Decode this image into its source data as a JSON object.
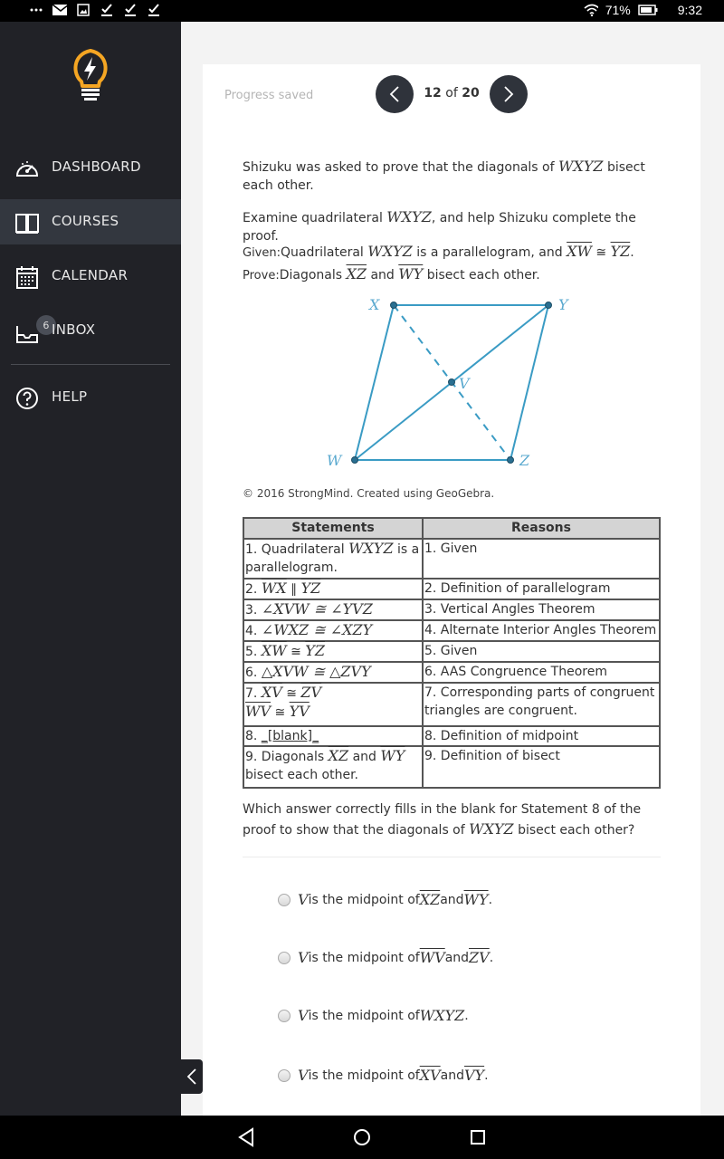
{
  "status_bar": {
    "battery_percent": "71%",
    "time": "9:32",
    "left_icons": [
      "more-icon",
      "mail-icon",
      "image-icon",
      "check-icon",
      "check-icon",
      "check-icon"
    ],
    "right_icons": [
      "wifi-icon",
      "battery-icon"
    ]
  },
  "sidebar": {
    "items": [
      {
        "label": "DASHBOARD",
        "icon": "speedometer-icon",
        "active": false
      },
      {
        "label": "COURSES",
        "icon": "book-icon",
        "active": true
      },
      {
        "label": "CALENDAR",
        "icon": "calendar-icon",
        "active": false
      },
      {
        "label": "INBOX",
        "icon": "inbox-icon",
        "active": false,
        "badge": "6"
      },
      {
        "label": "HELP",
        "icon": "help-icon",
        "active": false
      }
    ],
    "accent_color": "#f5a623"
  },
  "header": {
    "progress_status": "Progress saved",
    "current_page": "12",
    "page_sep": "of",
    "total_pages": "20"
  },
  "question": {
    "intro_a": "Shizuku was asked to prove that the diagonals of ",
    "intro_b": " bisect each other.",
    "quad": "WXYZ",
    "examine_a": "Examine quadrilateral ",
    "examine_b": ", and help Shizuku complete the proof.",
    "given_label": "Given:",
    "given_a": "Quadrilateral ",
    "given_b": " is a parallelogram, and ",
    "given_seg1": "XW",
    "given_seg2": "YZ",
    "prove_label": "Prove:",
    "prove_a": "Diagonals ",
    "prove_seg1": "XZ",
    "prove_and": " and ",
    "prove_seg2": "WY",
    "prove_b": " bisect each other.",
    "copyright": "© 2016 StrongMind. Created using GeoGebra.",
    "prompt_a": "Which answer correctly fills in the blank for Statement 8 of the proof to show that the diagonals of ",
    "prompt_b": " bisect each other?"
  },
  "diagram": {
    "points": {
      "X": "X",
      "Y": "Y",
      "Z": "Z",
      "W": "W",
      "V": "V"
    },
    "color": "#3a9bc4"
  },
  "proof_table": {
    "headers": [
      "Statements",
      "Reasons"
    ],
    "rows": [
      {
        "statement": "1. Quadrilateral WXYZ is a parallelogram.",
        "reason": "1. Given"
      },
      {
        "statement": "2. WX ∥ YZ",
        "reason": "2. Definition of parallelogram"
      },
      {
        "statement": "3. ∠XVW ≅ ∠YVZ",
        "reason": "3. Vertical Angles Theorem"
      },
      {
        "statement": "4. ∠WXZ ≅ ∠XZY",
        "reason": "4. Alternate Interior Angles Theorem"
      },
      {
        "statement": "5. XW ≅ YZ",
        "reason": "5. Given"
      },
      {
        "statement": "6. △XVW ≅ △ZVY",
        "reason": "6. AAS Congruence Theorem"
      },
      {
        "statement": "7. XV ≅ ZV, WV ≅ YV",
        "reason": "7. Corresponding parts of congruent triangles are congruent."
      },
      {
        "statement": "8. _[blank]_",
        "reason": "8. Definition of midpoint"
      },
      {
        "statement": "9. Diagonals XZ and WY bisect each other.",
        "reason": "9. Definition of bisect"
      }
    ]
  },
  "choices": [
    {
      "v": "V",
      "text": " is the midpoint of ",
      "seg1": "XZ",
      "and": " and ",
      "seg2": "WY",
      "end": "."
    },
    {
      "v": "V",
      "text": " is the midpoint of ",
      "seg1": "WV",
      "and": " and ",
      "seg2": "ZV",
      "end": "."
    },
    {
      "v": "V",
      "text": " is the midpoint of ",
      "seg1": "WXYZ",
      "and": "",
      "seg2": "",
      "end": "."
    },
    {
      "v": "V",
      "text": " is the midpoint of ",
      "seg1": "XV",
      "and": " and ",
      "seg2": "VY",
      "end": "."
    }
  ]
}
